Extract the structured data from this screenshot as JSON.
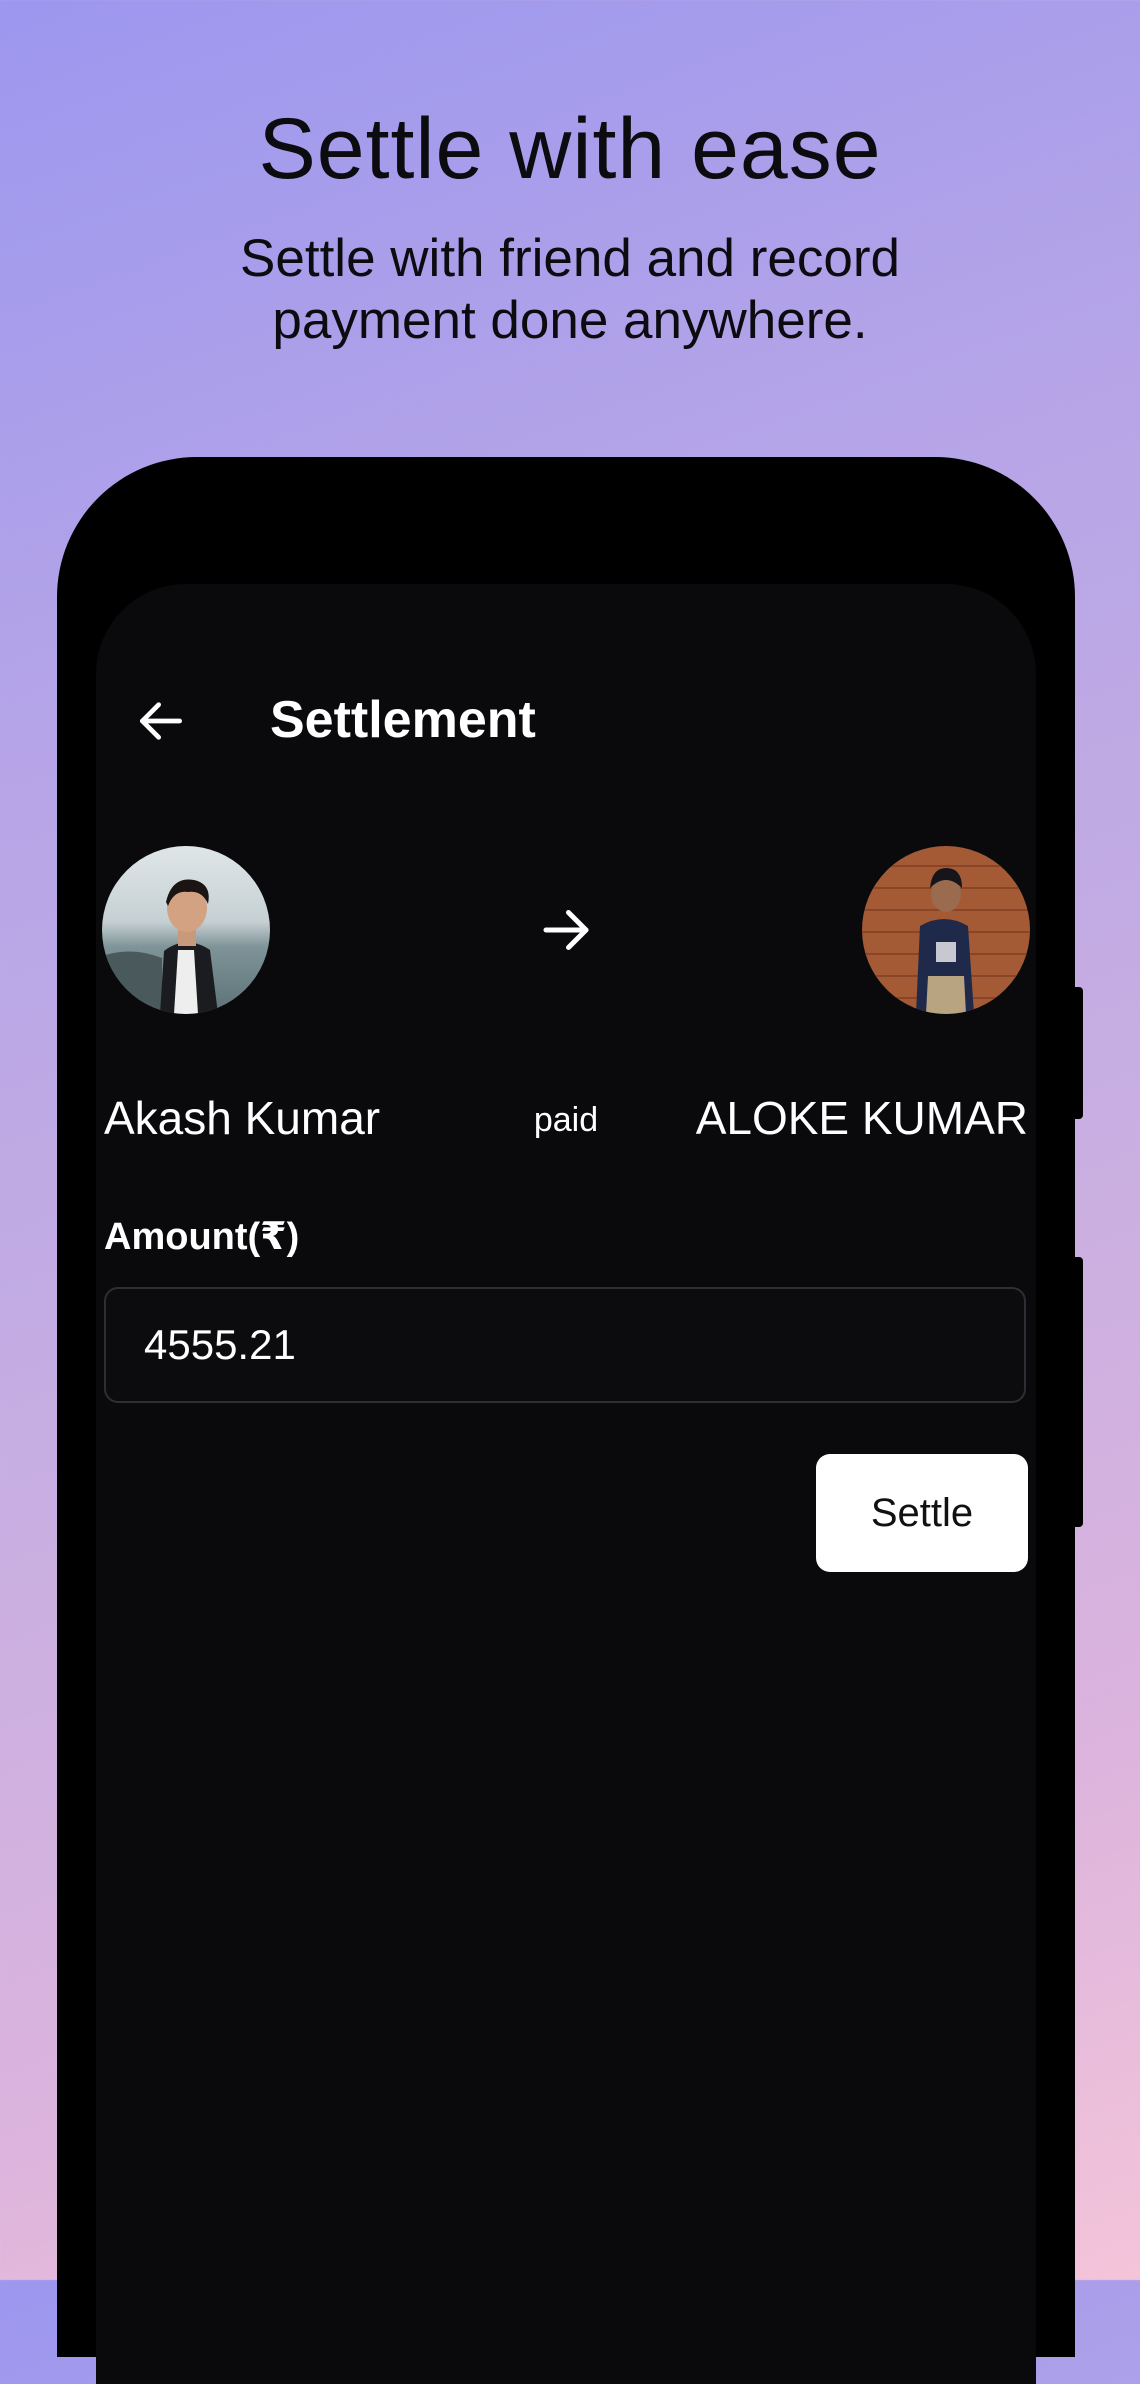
{
  "promo": {
    "headline": "Settle with ease",
    "subline_line1": "Settle with friend and record",
    "subline_line2": "payment done anywhere."
  },
  "header": {
    "title": "Settlement",
    "back_icon": "arrow-left-icon"
  },
  "payer": {
    "name": "Akash Kumar",
    "avatar": "avatar-photo"
  },
  "payee": {
    "name": "ALOKE KUMAR",
    "avatar": "avatar-photo"
  },
  "transfer": {
    "label": "paid",
    "icon": "arrow-right-icon"
  },
  "form": {
    "amount_label": "Amount(₹)",
    "amount_value": "4555.21",
    "submit_label": "Settle"
  },
  "colors": {
    "screen_background": "#0a0a0c",
    "button_background": "#ffffff",
    "field_border": "#2e2e33"
  }
}
